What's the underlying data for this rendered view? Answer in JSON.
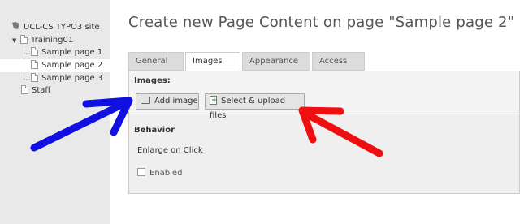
{
  "sidebar": {
    "site": {
      "label": "UCL-CS TYPO3 site",
      "icon": "site-icon"
    },
    "items": [
      {
        "label": "Training01",
        "icon": "page-icon",
        "expanded": true
      },
      {
        "label": "Sample page 1",
        "icon": "page-icon"
      },
      {
        "label": "Sample page 2",
        "icon": "page-icon",
        "selected": true
      },
      {
        "label": "Sample page 3",
        "icon": "page-icon"
      },
      {
        "label": "Staff",
        "icon": "page-icon"
      }
    ]
  },
  "main": {
    "title": "Create new Page Content on page \"Sample page 2\"",
    "tabs": [
      {
        "label": "General"
      },
      {
        "label": "Images",
        "active": true
      },
      {
        "label": "Appearance"
      },
      {
        "label": "Access"
      }
    ],
    "images": {
      "heading": "Images:",
      "add_button": "Add image",
      "upload_button": "Select & upload files"
    },
    "behavior": {
      "heading": "Behavior",
      "enlarge_label": "Enlarge on Click",
      "enabled_label": "Enabled",
      "enabled_checked": false
    }
  },
  "annotations": {
    "arrow_left_color": "#1010e0",
    "arrow_right_color": "#ee1010"
  }
}
